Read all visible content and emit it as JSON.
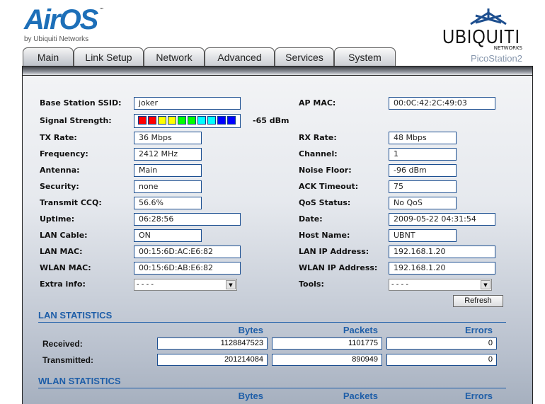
{
  "header": {
    "logo_text": "AirOS",
    "logo_tm": "™",
    "logo_by": "by Ubiquiti Networks",
    "brand": "UBIQUITI",
    "brand_sub": "NETWORKS",
    "model": "PicoStation2"
  },
  "tabs": [
    {
      "label": "Main",
      "active": true
    },
    {
      "label": "Link Setup"
    },
    {
      "label": "Network"
    },
    {
      "label": "Advanced"
    },
    {
      "label": "Services"
    },
    {
      "label": "System"
    }
  ],
  "left": [
    {
      "label": "Base Station SSID:",
      "value": "joker"
    },
    {
      "label": "Signal Strength:",
      "value": "-65 dBm"
    },
    {
      "label": "TX Rate:",
      "value": "36 Mbps"
    },
    {
      "label": "Frequency:",
      "value": "2412 MHz"
    },
    {
      "label": "Antenna:",
      "value": "Main"
    },
    {
      "label": "Security:",
      "value": "none"
    },
    {
      "label": "Transmit CCQ:",
      "value": "56.6%"
    },
    {
      "label": "Uptime:",
      "value": "06:28:56"
    },
    {
      "label": "LAN Cable:",
      "value": "ON"
    },
    {
      "label": "LAN MAC:",
      "value": "00:15:6D:AC:E6:82"
    },
    {
      "label": "WLAN MAC:",
      "value": "00:15:6D:AB:E6:82"
    },
    {
      "label": "Extra info:",
      "value": "- - - -"
    }
  ],
  "right": [
    {
      "label": "AP MAC:",
      "value": "00:0C:42:2C:49:03"
    },
    {
      "label": "RX Rate:",
      "value": "48 Mbps"
    },
    {
      "label": "Channel:",
      "value": "1"
    },
    {
      "label": "Noise Floor:",
      "value": "-96 dBm"
    },
    {
      "label": "ACK Timeout:",
      "value": "75"
    },
    {
      "label": "QoS Status:",
      "value": "No QoS"
    },
    {
      "label": "Date:",
      "value": "2009-05-22 04:31:54"
    },
    {
      "label": "Host Name:",
      "value": "UBNT"
    },
    {
      "label": "LAN IP Address:",
      "value": "192.168.1.20"
    },
    {
      "label": "WLAN IP Address:",
      "value": "192.168.1.20"
    },
    {
      "label": "Tools:",
      "value": "- - - -"
    }
  ],
  "signal_bars": {
    "filled": 10,
    "colors": [
      "#ff0000",
      "#ff0000",
      "#ffff00",
      "#ffff00",
      "#00ff00",
      "#00ff00",
      "#00ffff",
      "#00ffff",
      "#0000ff",
      "#0000ff"
    ]
  },
  "refresh_label": "Refresh",
  "lan_stats": {
    "title": "LAN STATISTICS",
    "columns": [
      "Bytes",
      "Packets",
      "Errors"
    ],
    "rows": [
      {
        "label": "Received:",
        "values": [
          "1128847523",
          "1101775",
          "0"
        ]
      },
      {
        "label": "Transmitted:",
        "values": [
          "201214084",
          "890949",
          "0"
        ]
      }
    ]
  },
  "wlan_stats": {
    "title": "WLAN STATISTICS",
    "columns": [
      "Bytes",
      "Packets",
      "Errors"
    ]
  }
}
